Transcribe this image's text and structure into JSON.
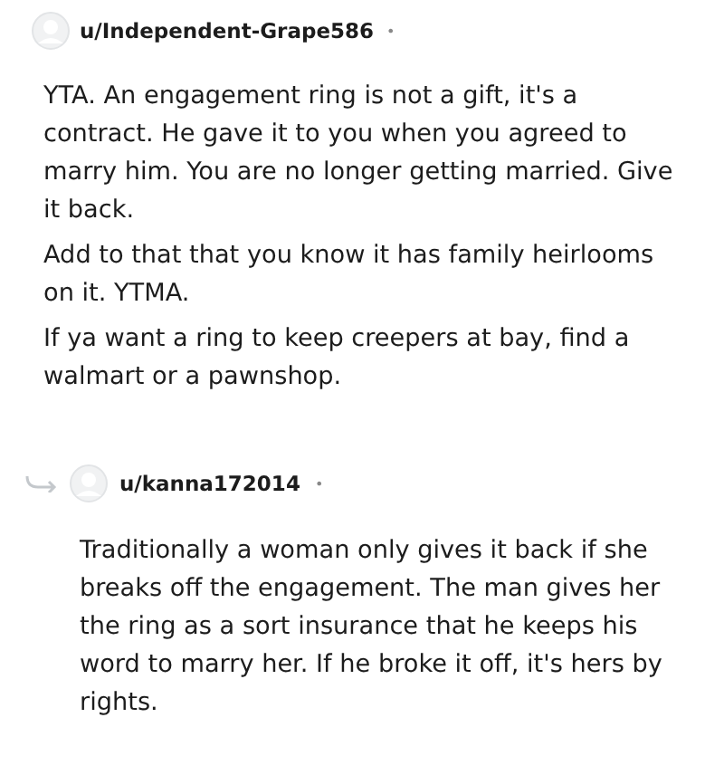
{
  "comments": [
    {
      "username": "u/Independent-Grape586",
      "separator": "•",
      "is_reply": false,
      "paragraphs": [
        "YTA. An engagement ring is not a gift, it's a contract. He gave it to you when you agreed to marry him. You are no longer getting married. Give it back.",
        "Add to that that you know it has family heirlooms on it. YTMA.",
        "If ya want a ring to keep creepers at bay, find a walmart or a pawnshop."
      ]
    },
    {
      "username": "u/kanna172014",
      "separator": "•",
      "is_reply": true,
      "paragraphs": [
        "Traditionally a woman only gives it back if she breaks off the engagement. The man gives her the ring as a sort insurance that he keeps his word to marry her. If he broke it off, it's hers by rights."
      ]
    }
  ]
}
